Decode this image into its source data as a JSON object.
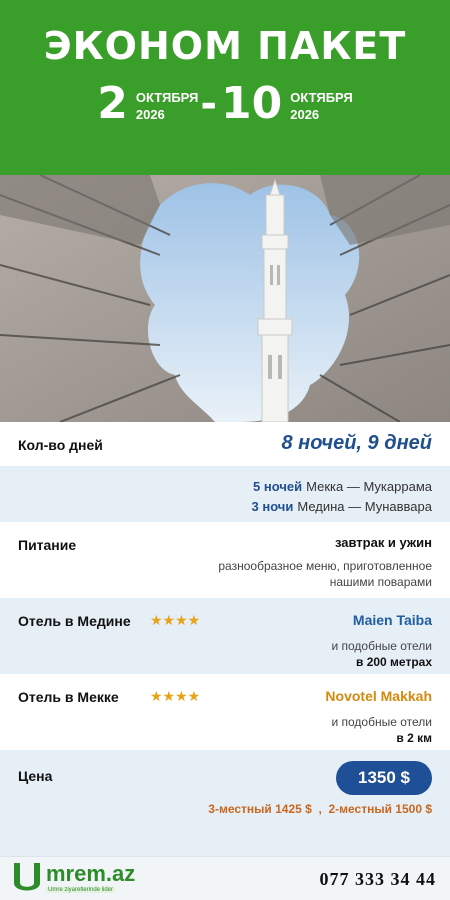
{
  "header": {
    "title": "ЭКОНОМ ПАКЕТ",
    "start_day": "2",
    "start_month": "ОКТЯБРЯ",
    "start_year": "2026",
    "separator": "-",
    "end_day": "10",
    "end_month": "ОКТЯБРЯ",
    "end_year": "2026"
  },
  "days": {
    "label": "Кол-во дней",
    "value": "8 ночей, 9 дней",
    "mecca_nights": "5 ночей",
    "mecca_city": "Мекка — Мукаррама",
    "medina_nights": "3 ночи",
    "medina_city": "Медина — Мунаввара"
  },
  "food": {
    "label": "Питание",
    "value": "завтрак и ужин",
    "note_line1": "разнообразное меню, приготовленное",
    "note_line2": "нашими поварами"
  },
  "hotel_medina": {
    "label": "Отель в Медине",
    "stars": "★★★★",
    "name": "Maien Taiba",
    "note": "и подобные отели",
    "distance": "в 200 метрах"
  },
  "hotel_mecca": {
    "label": "Отель в Мекке",
    "stars": "★★★★",
    "name": "Novotel Makkah",
    "note": "и подобные отели",
    "distance": "в 2 км"
  },
  "price": {
    "label": "Цена",
    "value": "1350 $",
    "alt": "3-местный 1425 $  ,  2-местный 1500 $"
  },
  "footer": {
    "logo_text": "mrem.az",
    "logo_sub": "Umre ziyaretlerinde lider",
    "phone": "077 333 34 44"
  },
  "colors": {
    "header_green": "#3a9e2a",
    "accent_blue": "#1f4f8e",
    "star_gold": "#e8a215",
    "price_orange": "#c9671e"
  }
}
